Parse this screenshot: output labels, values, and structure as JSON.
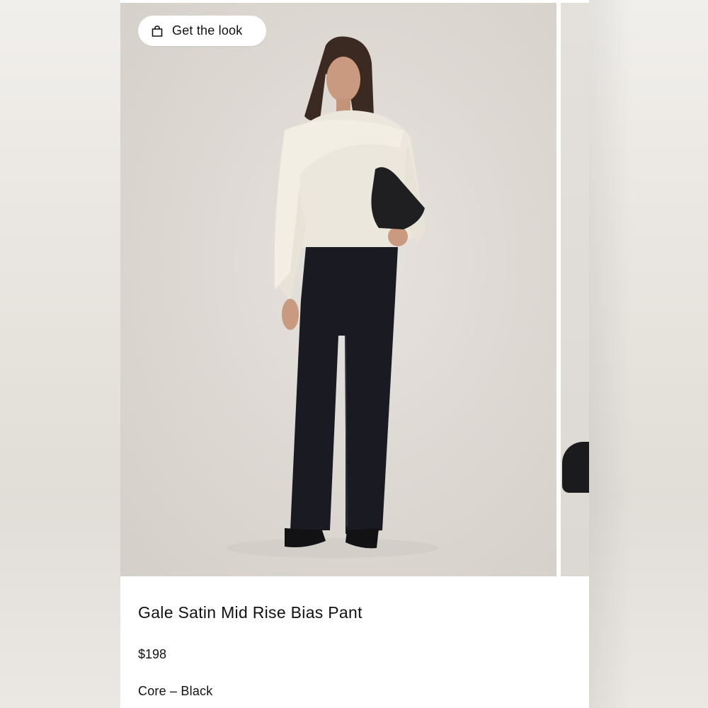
{
  "get_look": {
    "label": "Get the look",
    "icon": "shopping-bag-icon"
  },
  "product": {
    "name": "Gale Satin Mid Rise Bias Pant",
    "price": "$198",
    "color": "Core – Black"
  },
  "colors": {
    "text": "#111111",
    "card_bg": "#ffffff",
    "photo_bg": "#dcd7d1"
  }
}
